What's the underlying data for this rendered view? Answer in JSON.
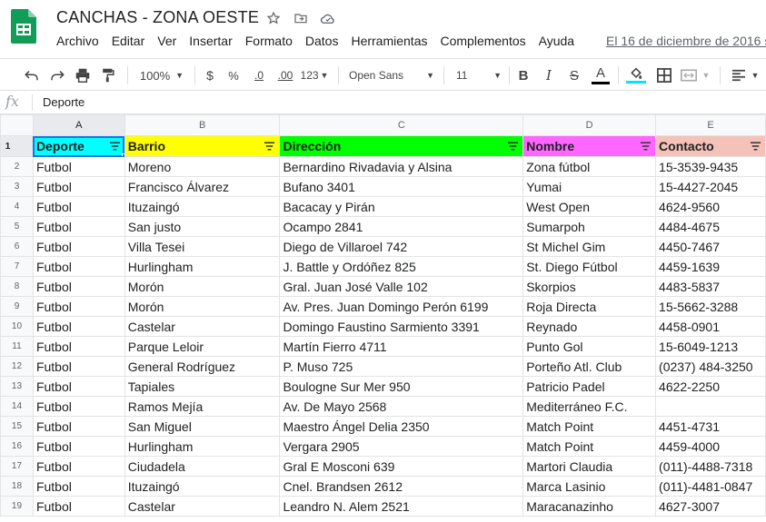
{
  "doc": {
    "title": "CANCHAS - ZONA OESTE",
    "last_edit": "El 16 de diciembre de 2016 s"
  },
  "menu": [
    "Archivo",
    "Editar",
    "Ver",
    "Insertar",
    "Formato",
    "Datos",
    "Herramientas",
    "Complementos",
    "Ayuda"
  ],
  "toolbar": {
    "zoom": "100%",
    "currency": "$",
    "percent": "%",
    "dec_decrease": ".0",
    "dec_increase": ".00",
    "format_more": "123",
    "font": "Open Sans",
    "font_size": "11",
    "bold": "B",
    "italic": "I",
    "strike": "S",
    "text_color": "A"
  },
  "formula": {
    "fx": "fx",
    "value": "Deporte"
  },
  "columns": [
    "A",
    "B",
    "C",
    "D",
    "E"
  ],
  "header_row": {
    "number": "1",
    "cells": [
      "Deporte",
      "Barrio",
      "Dirección",
      "Nombre",
      "Contacto"
    ],
    "colors": [
      "#00ffff",
      "#ffff00",
      "#00ff00",
      "#ff66ff",
      "#f4c2b8"
    ]
  },
  "rows": [
    {
      "n": "2",
      "c": [
        "Futbol",
        "Moreno",
        "Bernardino Rivadavia y Alsina",
        "Zona fútbol",
        "15-3539-9435"
      ]
    },
    {
      "n": "3",
      "c": [
        "Futbol",
        "Francisco Álvarez",
        "Bufano 3401",
        "Yumai",
        "15-4427-2045"
      ]
    },
    {
      "n": "4",
      "c": [
        "Futbol",
        "Ituzaingó",
        "Bacacay y Pirán",
        "West Open",
        "4624-9560"
      ]
    },
    {
      "n": "5",
      "c": [
        "Futbol",
        "San justo",
        "Ocampo 2841",
        "Sumarpoh",
        "4484-4675"
      ]
    },
    {
      "n": "6",
      "c": [
        "Futbol",
        "Villa Tesei",
        "Diego de Villaroel 742",
        "St Michel Gim",
        "4450-7467"
      ]
    },
    {
      "n": "7",
      "c": [
        "Futbol",
        "Hurlingham",
        "J. Battle y Ordóñez 825",
        "St. Diego Fútbol",
        "4459-1639"
      ]
    },
    {
      "n": "8",
      "c": [
        "Futbol",
        "Morón",
        "Gral. Juan José Valle 102",
        "Skorpios",
        "4483-5837"
      ]
    },
    {
      "n": "9",
      "c": [
        "Futbol",
        "Morón",
        "Av. Pres. Juan Domingo Perón 6199",
        "Roja Directa",
        "15-5662-3288"
      ]
    },
    {
      "n": "10",
      "c": [
        "Futbol",
        "Castelar",
        "Domingo Faustino Sarmiento 3391",
        "Reynado",
        "4458-0901"
      ]
    },
    {
      "n": "11",
      "c": [
        "Futbol",
        "Parque Leloir",
        "Martín Fierro 4711",
        "Punto Gol",
        "15-6049-1213"
      ]
    },
    {
      "n": "12",
      "c": [
        "Futbol",
        "General Rodríguez",
        "P. Muso 725",
        "Porteño Atl. Club",
        "(0237) 484-3250"
      ]
    },
    {
      "n": "13",
      "c": [
        "Futbol",
        "Tapiales",
        "Boulogne Sur Mer 950",
        "Patricio Padel",
        "4622-2250"
      ]
    },
    {
      "n": "14",
      "c": [
        "Futbol",
        "Ramos Mejía",
        "Av. De Mayo 2568",
        "Mediterráneo F.C.",
        ""
      ]
    },
    {
      "n": "15",
      "c": [
        "Futbol",
        "San Miguel",
        "Maestro Ángel Delia 2350",
        "Match Point",
        "4451-4731"
      ]
    },
    {
      "n": "16",
      "c": [
        "Futbol",
        "Hurlingham",
        "Vergara 2905",
        "Match Point",
        "4459-4000"
      ]
    },
    {
      "n": "17",
      "c": [
        "Futbol",
        "Ciudadela",
        "Gral E Mosconi 639",
        "Martori Claudia",
        "(011)-4488-7318"
      ]
    },
    {
      "n": "18",
      "c": [
        "Futbol",
        "Ituzaingó",
        "Cnel. Brandsen 2612",
        "Marca Lasinio",
        "(011)-4481-0847"
      ]
    },
    {
      "n": "19",
      "c": [
        "Futbol",
        "Castelar",
        "Leandro N. Alem 2521",
        "Maracanazinho",
        "4627-3007"
      ]
    }
  ]
}
